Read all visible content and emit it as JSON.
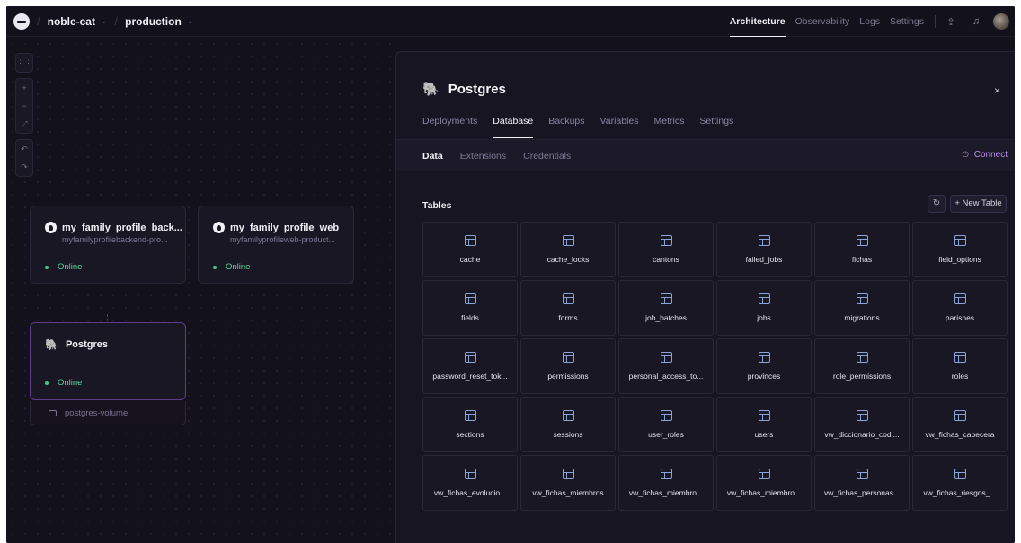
{
  "breadcrumb": {
    "project": "noble-cat",
    "environment": "production"
  },
  "top_nav": {
    "items": [
      "Architecture",
      "Observability",
      "Logs",
      "Settings"
    ],
    "active": "Architecture"
  },
  "canvas": {
    "services": [
      {
        "name": "my_family_profile_back...",
        "domain": "myfamilyprofilebackend-pro...",
        "status": "Online"
      },
      {
        "name": "my_family_profile_web",
        "domain": "myfamilyprofileweb-product...",
        "status": "Online"
      }
    ],
    "database": {
      "name": "Postgres",
      "status": "Online",
      "volume": "postgres-volume"
    }
  },
  "panel": {
    "title": "Postgres",
    "close": "×",
    "tabs": [
      "Deployments",
      "Database",
      "Backups",
      "Variables",
      "Metrics",
      "Settings"
    ],
    "active_tab": "Database",
    "subtabs": [
      "Data",
      "Extensions",
      "Credentials"
    ],
    "active_subtab": "Data",
    "connect_label": "Connect",
    "tables_label": "Tables",
    "new_table_label": "+ New Table",
    "tables": [
      "cache",
      "cache_locks",
      "cantons",
      "failed_jobs",
      "fichas",
      "field_options",
      "fields",
      "forms",
      "job_batches",
      "jobs",
      "migrations",
      "parishes",
      "password_reset_tok...",
      "permissions",
      "personal_access_to...",
      "provinces",
      "role_permissions",
      "roles",
      "sections",
      "sessions",
      "user_roles",
      "users",
      "vw_diccionario_codi...",
      "vw_fichas_cabecera",
      "vw_fichas_evolucio...",
      "vw_fichas_miembros",
      "vw_fichas_miembro...",
      "vw_fichas_miembro...",
      "vw_fichas_personas...",
      "vw_fichas_riesgos_..."
    ]
  },
  "colors": {
    "background": "#13111c",
    "accent": "#b78cf0",
    "online": "#4bc28a"
  }
}
